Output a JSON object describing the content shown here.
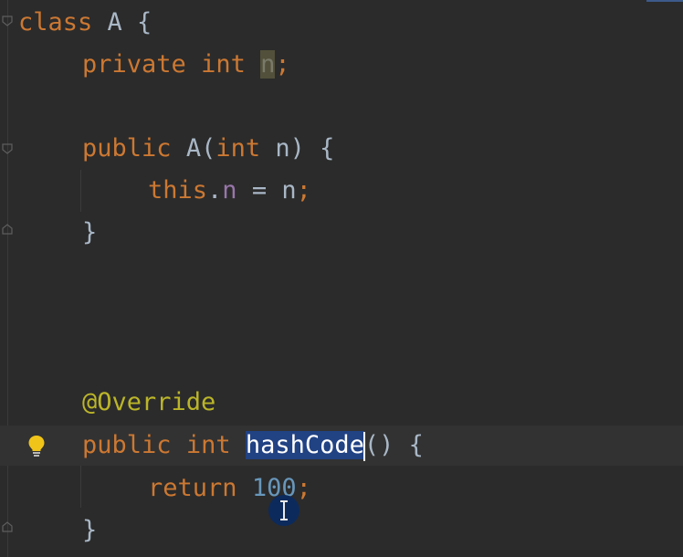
{
  "code": {
    "line1": {
      "kw": "class",
      "name": " A {"
    },
    "line2": {
      "kw1": "private",
      "kw2": "int",
      "field": "n",
      "end": ";"
    },
    "line3": {
      "kw": "public",
      "name": "A(",
      "kw2": "int",
      "rest": " n) {"
    },
    "line4": {
      "kw": "this",
      "dot": ".",
      "field": "n",
      "rest": " = n",
      "end": ";"
    },
    "line5": {
      "text": "}"
    },
    "line6": {
      "annotation": "@Override"
    },
    "line7": {
      "kw1": "public",
      "kw2": "int",
      "method": "hashCode",
      "rest": "() {"
    },
    "line8": {
      "kw": "return",
      "number": "100",
      "end": ";"
    },
    "line9": {
      "text": "}"
    }
  },
  "icons": {
    "intention": "lightbulb-icon",
    "fold": "fold-marker-icon",
    "cursor": "text-ibeam-cursor-icon"
  },
  "colors": {
    "background": "#2b2b2b",
    "keyword": "#cc7832",
    "annotation": "#bbb529",
    "field": "#9876aa",
    "number": "#6897bb",
    "text": "#a9b7c6",
    "selection": "#214283"
  }
}
